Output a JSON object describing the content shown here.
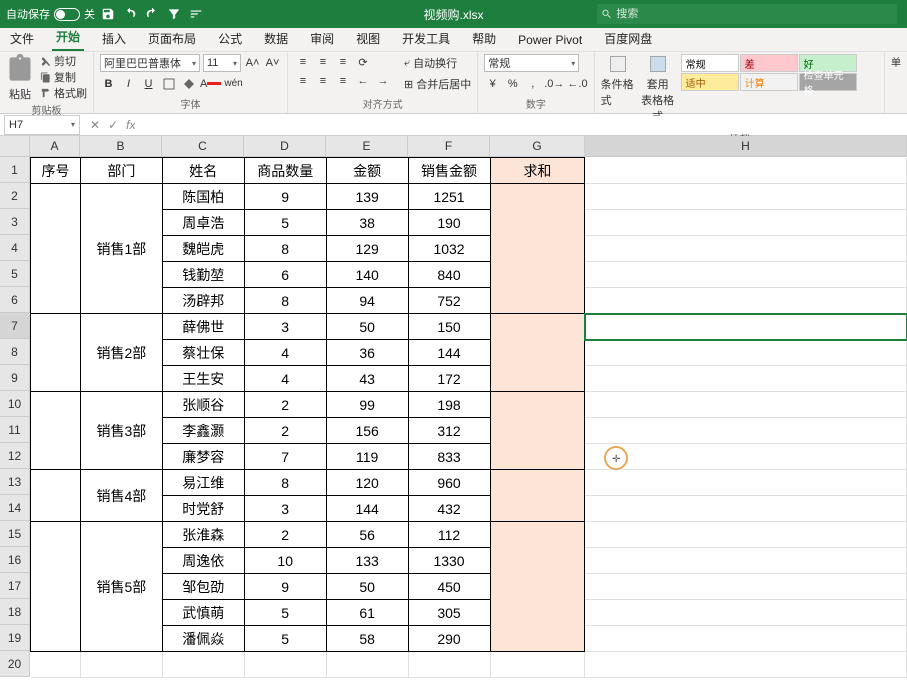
{
  "titlebar": {
    "autosave_label": "自动保存",
    "autosave_state": "关",
    "filename": "视频购.xlsx",
    "search_placeholder": "搜索"
  },
  "menubar": {
    "tabs": [
      "文件",
      "开始",
      "插入",
      "页面布局",
      "公式",
      "数据",
      "审阅",
      "视图",
      "开发工具",
      "帮助",
      "Power Pivot",
      "百度网盘"
    ],
    "active_index": 1
  },
  "ribbon": {
    "clipboard": {
      "paste": "粘贴",
      "cut": "剪切",
      "copy": "复制",
      "format_painter": "格式刷",
      "label": "剪贴板"
    },
    "font": {
      "family": "阿里巴巴普惠体",
      "size": "11",
      "increase": "A˄",
      "decrease": "A˅",
      "label": "字体"
    },
    "alignment": {
      "wrap": "自动换行",
      "merge": "合并后居中",
      "label": "对齐方式"
    },
    "number": {
      "format": "常规",
      "label": "数字"
    },
    "styles": {
      "cond": "条件格式",
      "table": "套用\n表格格式",
      "cells": [
        {
          "text": "常规",
          "bg": "#fff",
          "color": "#000"
        },
        {
          "text": "差",
          "bg": "#ffc7ce",
          "color": "#9c0006"
        },
        {
          "text": "好",
          "bg": "#c6efce",
          "color": "#006100"
        },
        {
          "text": "适中",
          "bg": "#ffeb9c",
          "color": "#9c5700"
        },
        {
          "text": "计算",
          "bg": "#f2f2f2",
          "color": "#fa7d00"
        },
        {
          "text": "检查单元格",
          "bg": "#a5a5a5",
          "color": "#fff"
        }
      ],
      "label": "样式"
    },
    "cells_group": {
      "label": "单"
    }
  },
  "namebox": {
    "cell": "H7"
  },
  "columns": [
    "A",
    "B",
    "C",
    "D",
    "E",
    "F",
    "G",
    "H"
  ],
  "selected_col": "H",
  "selected_row": 7,
  "table": {
    "headers": [
      "序号",
      "部门",
      "姓名",
      "商品数量",
      "金额",
      "销售金额",
      "求和"
    ],
    "depts": [
      {
        "name": "销售1部",
        "rows": [
          [
            "陈国柏",
            "9",
            "139",
            "1251"
          ],
          [
            "周卓浩",
            "5",
            "38",
            "190"
          ],
          [
            "魏皑虎",
            "8",
            "129",
            "1032"
          ],
          [
            "钱勤堃",
            "6",
            "140",
            "840"
          ],
          [
            "汤辟邦",
            "8",
            "94",
            "752"
          ]
        ]
      },
      {
        "name": "销售2部",
        "rows": [
          [
            "薛佛世",
            "3",
            "50",
            "150"
          ],
          [
            "蔡壮保",
            "4",
            "36",
            "144"
          ],
          [
            "王生安",
            "4",
            "43",
            "172"
          ]
        ]
      },
      {
        "name": "销售3部",
        "rows": [
          [
            "张顺谷",
            "2",
            "99",
            "198"
          ],
          [
            "李鑫灏",
            "2",
            "156",
            "312"
          ],
          [
            "廉梦容",
            "7",
            "119",
            "833"
          ]
        ]
      },
      {
        "name": "销售4部",
        "rows": [
          [
            "易江维",
            "8",
            "120",
            "960"
          ],
          [
            "时党舒",
            "3",
            "144",
            "432"
          ]
        ]
      },
      {
        "name": "销售5部",
        "rows": [
          [
            "张淮森",
            "2",
            "56",
            "112"
          ],
          [
            "周逸依",
            "10",
            "133",
            "1330"
          ],
          [
            "邹包劭",
            "9",
            "50",
            "450"
          ],
          [
            "武慎萌",
            "5",
            "61",
            "305"
          ],
          [
            "潘佩焱",
            "5",
            "58",
            "290"
          ]
        ]
      }
    ]
  }
}
